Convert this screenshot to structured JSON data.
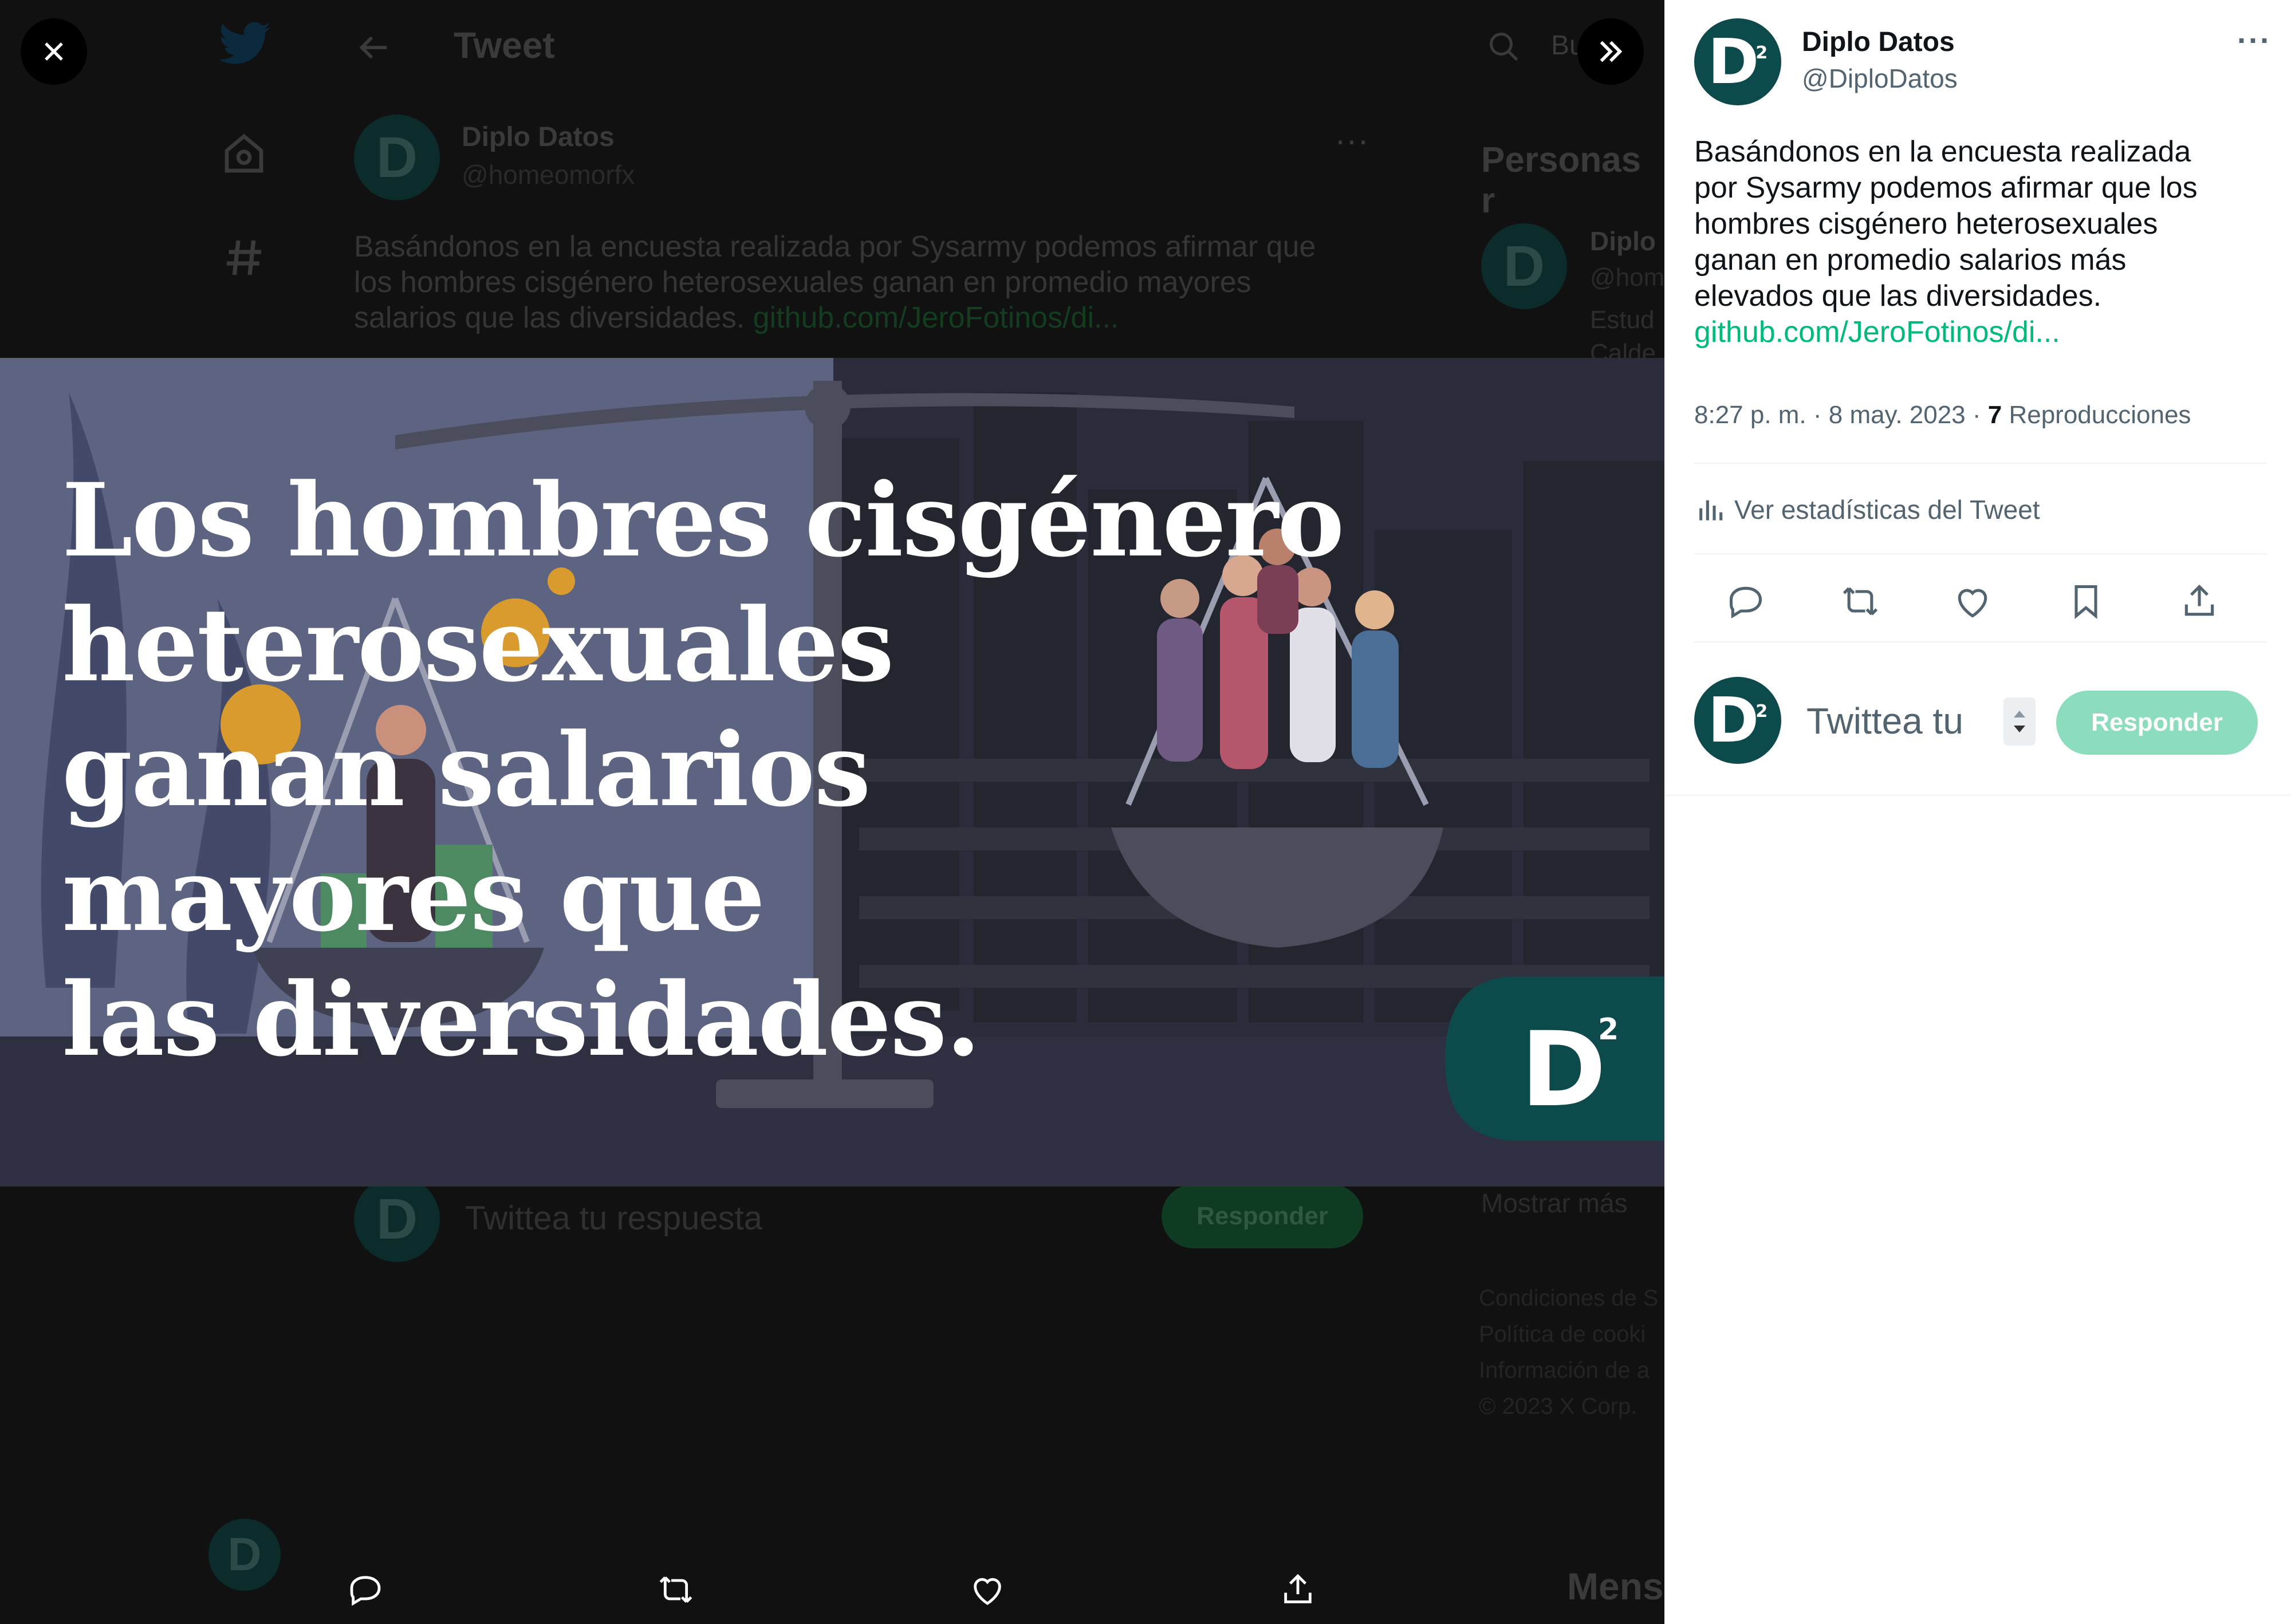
{
  "background": {
    "app": "Twitter",
    "header_title": "Tweet",
    "tweet": {
      "display_name": "Diplo Datos",
      "handle": "@homeomorfx",
      "text_line1": "Basándonos en la encuesta realizada por Sysarmy podemos afirmar que",
      "text_line2": "los hombres cisgénero heterosexuales ganan en promedio mayores",
      "text_line3": "salarios que las diversidades.",
      "link": "github.com/JeroFotinos/di...",
      "reply_placeholder": "Twittea tu respuesta",
      "reply_button": "Responder"
    },
    "search_placeholder": "Bu",
    "sidebar": {
      "section_title": "Personas r",
      "person_name": "Diplo",
      "person_handle": "@hom",
      "person_bio_1": "Estud",
      "person_bio_2": "Calde",
      "show_more": "Mostrar más",
      "footer": [
        "Condiciones de S",
        "Política de cooki",
        "Información de a",
        "© 2023 X Corp."
      ],
      "messages": "Mens"
    }
  },
  "media": {
    "headline": [
      "Los hombres cisgénero",
      "heterosexuales",
      "ganan salarios",
      "mayores que",
      "las diversidades."
    ],
    "logo_text": "D",
    "logo_sup": "2",
    "colors": {
      "logo_teal": "#0d4a4c",
      "backdrop_navy": "#2b2d3c"
    }
  },
  "viewer": {
    "close_icon": "close-icon",
    "expand_icon": "chevron-double-right-icon",
    "actions": [
      "reply-icon",
      "retweet-icon",
      "like-icon",
      "share-icon"
    ]
  },
  "panel": {
    "display_name": "Diplo Datos",
    "handle": "@DiploDatos",
    "avatar_text": "D",
    "avatar_sup": "2",
    "more_icon": "more-icon",
    "text": [
      "Basándonos en la encuesta realizada",
      "por Sysarmy podemos afirmar que los",
      "hombres cisgénero heterosexuales",
      "ganan en promedio salarios más",
      "elevados que las diversidades."
    ],
    "link": "github.com/JeroFotinos/di...",
    "timestamp": "8:27 p. m. · 8 may. 2023 · ",
    "views_count": "7",
    "views_label": " Reproducciones",
    "analytics": "Ver estadísticas del Tweet",
    "reply_placeholder": "Twittea tu",
    "reply_button": "Responder",
    "colors": {
      "link_green": "#00ba7c",
      "reply_button_bg": "#8cdcbe"
    }
  }
}
